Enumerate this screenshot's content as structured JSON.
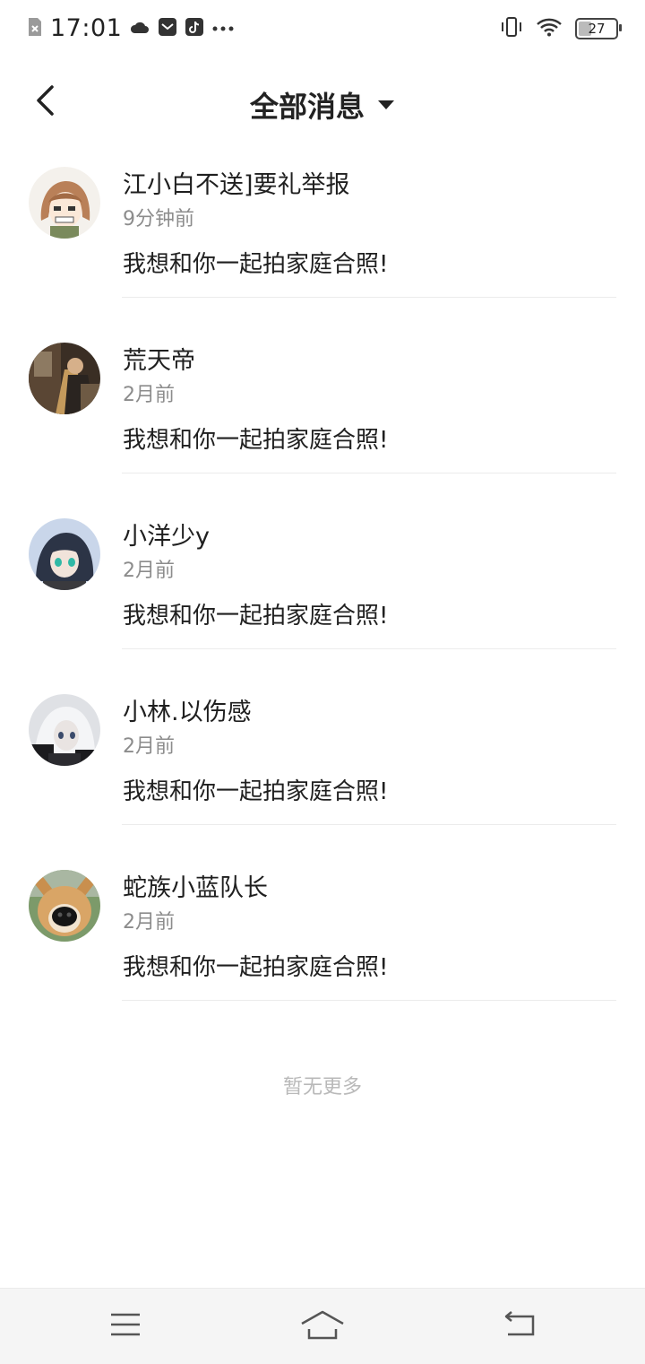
{
  "status_bar": {
    "time": "17:01",
    "battery_level": "27",
    "icons": [
      "sim-off-icon",
      "cloud-icon",
      "mail-icon",
      "tiktok-icon",
      "more-dots-icon",
      "vibrate-icon",
      "wifi-icon",
      "battery-icon"
    ]
  },
  "header": {
    "title": "全部消息",
    "back_icon": "back-arrow-icon",
    "dropdown_icon": "dropdown-triangle-icon"
  },
  "messages": [
    {
      "name": "江小白不送]要礼举报",
      "time": "9分钟前",
      "text": "我想和你一起拍家庭合照!",
      "avatar": "anime-girl-avatar"
    },
    {
      "name": "荒天帝",
      "time": "2月前",
      "text": "我想和你一起拍家庭合照!",
      "avatar": "photo-avatar"
    },
    {
      "name": "小洋少y",
      "time": "2月前",
      "text": "我想和你一起拍家庭合照!",
      "avatar": "anime-boy-avatar"
    },
    {
      "name": "小林.以伤感",
      "time": "2月前",
      "text": "我想和你一起拍家庭合照!",
      "avatar": "anime-white-hair-avatar"
    },
    {
      "name": "蛇族小蓝队长",
      "time": "2月前",
      "text": "我想和你一起拍家庭合照!",
      "avatar": "dog-avatar"
    }
  ],
  "footer": {
    "no_more": "暂无更多"
  },
  "nav_bar": {
    "icons": [
      "menu-icon",
      "home-icon",
      "back-icon"
    ]
  },
  "colors": {
    "text_primary": "#1f1f1f",
    "text_secondary": "#8c8c8c",
    "divider": "#ececec",
    "nav_bg": "#f5f5f5"
  }
}
